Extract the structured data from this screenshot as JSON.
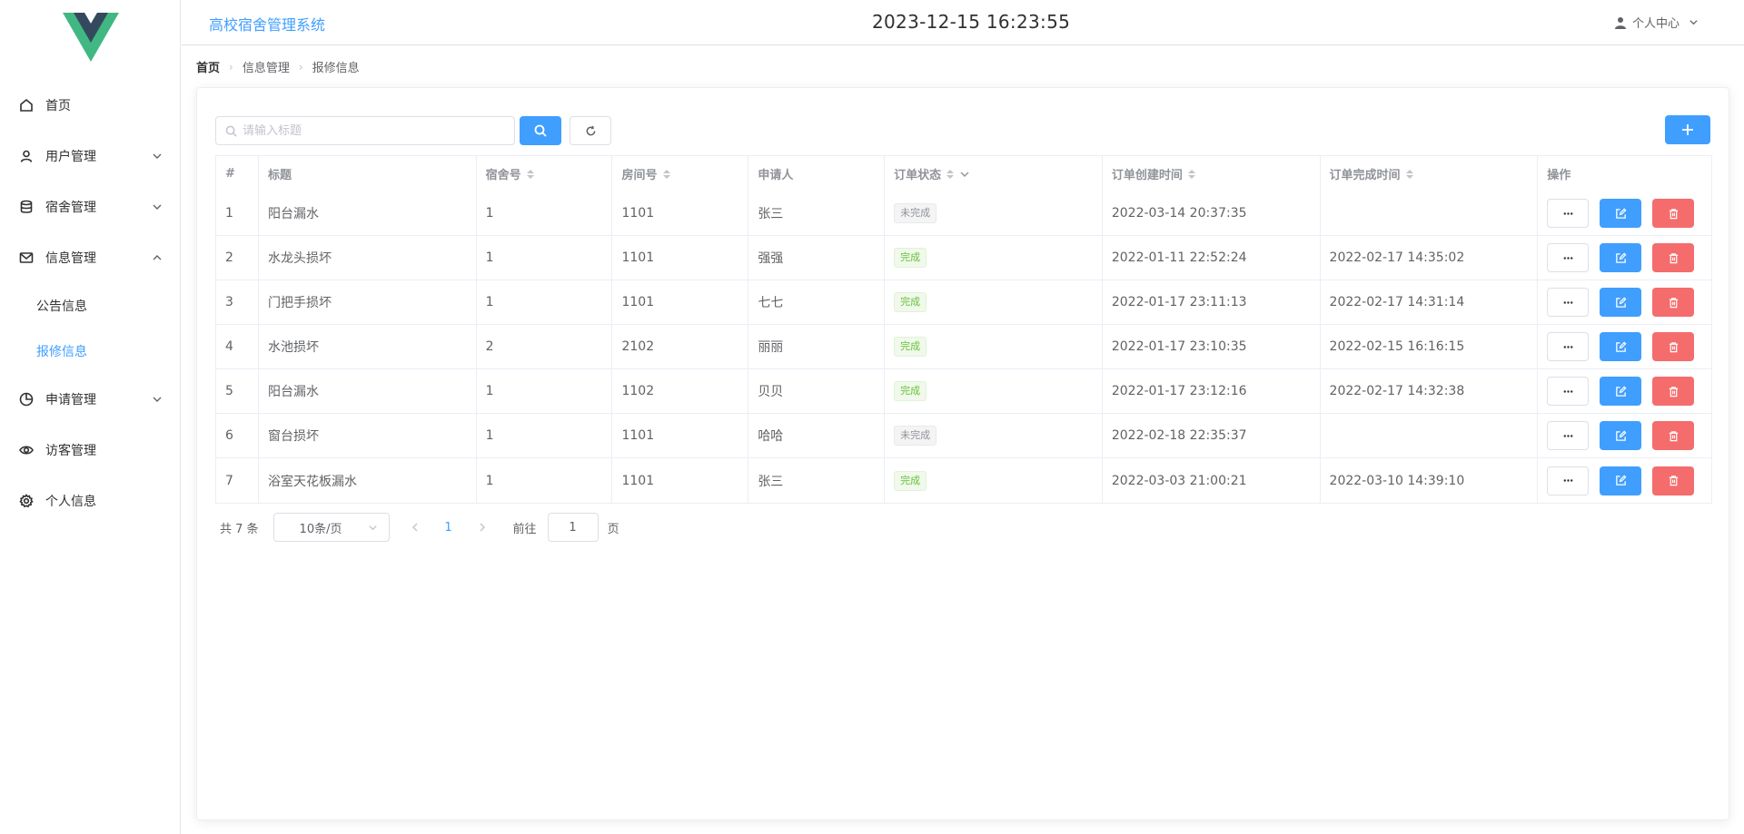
{
  "app": {
    "title": "高校宿舍管理系统",
    "clock": "2023-12-15 16:23:55",
    "user_center": "个人中心"
  },
  "colors": {
    "primary": "#409eff",
    "danger": "#f56c6c",
    "success": "#67c23a",
    "logo_green": "#41b883",
    "logo_dark": "#34495e"
  },
  "sidebar": {
    "items": [
      {
        "label": "首页",
        "icon": "home-icon"
      },
      {
        "label": "用户管理",
        "icon": "user-icon",
        "expandable": true,
        "expanded": false
      },
      {
        "label": "宿舍管理",
        "icon": "database-icon",
        "expandable": true,
        "expanded": false
      },
      {
        "label": "信息管理",
        "icon": "mail-icon",
        "expandable": true,
        "expanded": true,
        "children": [
          {
            "label": "公告信息"
          },
          {
            "label": "报修信息",
            "active": true
          }
        ]
      },
      {
        "label": "申请管理",
        "icon": "pie-chart-icon",
        "expandable": true,
        "expanded": false
      },
      {
        "label": "访客管理",
        "icon": "eye-icon"
      },
      {
        "label": "个人信息",
        "icon": "gear-icon"
      }
    ]
  },
  "breadcrumb": [
    "首页",
    "信息管理",
    "报修信息"
  ],
  "search": {
    "placeholder": "请输入标题",
    "value": ""
  },
  "table": {
    "columns": [
      "#",
      "标题",
      "宿舍号",
      "房间号",
      "申请人",
      "订单状态",
      "订单创建时间",
      "订单完成时间",
      "操作"
    ],
    "rows": [
      {
        "index": "1",
        "title": "阳台漏水",
        "dorm": "1",
        "room": "1101",
        "applicant": "张三",
        "status": "未完成",
        "created": "2022-03-14 20:37:35",
        "finished": ""
      },
      {
        "index": "2",
        "title": "水龙头损坏",
        "dorm": "1",
        "room": "1101",
        "applicant": "强强",
        "status": "完成",
        "created": "2022-01-11 22:52:24",
        "finished": "2022-02-17 14:35:02"
      },
      {
        "index": "3",
        "title": "门把手损坏",
        "dorm": "1",
        "room": "1101",
        "applicant": "七七",
        "status": "完成",
        "created": "2022-01-17 23:11:13",
        "finished": "2022-02-17 14:31:14"
      },
      {
        "index": "4",
        "title": "水池损坏",
        "dorm": "2",
        "room": "2102",
        "applicant": "丽丽",
        "status": "完成",
        "created": "2022-01-17 23:10:35",
        "finished": "2022-02-15 16:16:15"
      },
      {
        "index": "5",
        "title": "阳台漏水",
        "dorm": "1",
        "room": "1102",
        "applicant": "贝贝",
        "status": "完成",
        "created": "2022-01-17 23:12:16",
        "finished": "2022-02-17 14:32:38"
      },
      {
        "index": "6",
        "title": "窗台损坏",
        "dorm": "1",
        "room": "1101",
        "applicant": "哈哈",
        "status": "未完成",
        "created": "2022-02-18 22:35:37",
        "finished": ""
      },
      {
        "index": "7",
        "title": "浴室天花板漏水",
        "dorm": "1",
        "room": "1101",
        "applicant": "张三",
        "status": "完成",
        "created": "2022-03-03 21:00:21",
        "finished": "2022-03-10 14:39:10"
      }
    ]
  },
  "pagination": {
    "total_text": "共 7 条",
    "page_size": "10条/页",
    "current_page": "1",
    "goto_label": "前往",
    "goto_value": "1",
    "goto_unit": "页"
  }
}
